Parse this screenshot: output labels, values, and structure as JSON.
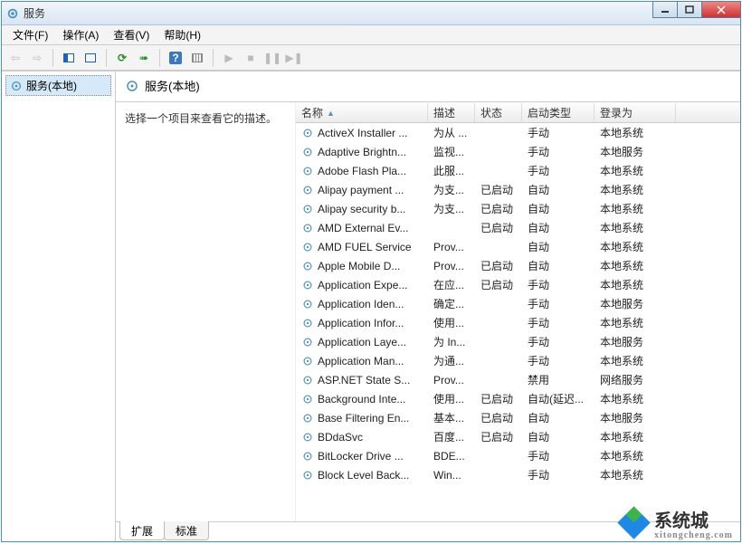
{
  "window": {
    "title": "服务",
    "url_hint": "...",
    "min_tooltip": "最小化",
    "max_tooltip": "最大化",
    "close_tooltip": "关闭"
  },
  "menus": [
    "文件(F)",
    "操作(A)",
    "查看(V)",
    "帮助(H)"
  ],
  "toolbar_icons": {
    "back": "←",
    "forward": "→",
    "up": "⇧",
    "show_tree": "▤",
    "refresh": "⟳",
    "export": "✎",
    "help": "?",
    "props": "☰",
    "start": "▶",
    "stop": "■",
    "pause": "❚❚",
    "restart": "⟲",
    "resume": "▸❚"
  },
  "tree": {
    "root_label": "服务(本地)"
  },
  "detail": {
    "title": "服务(本地)",
    "description_prompt": "选择一个项目来查看它的描述。"
  },
  "columns": {
    "name": "名称",
    "desc": "描述",
    "status": "状态",
    "startup": "启动类型",
    "logon": "登录为"
  },
  "services": [
    {
      "name": "ActiveX Installer ...",
      "desc": "为从 ...",
      "status": "",
      "startup": "手动",
      "logon": "本地系统"
    },
    {
      "name": "Adaptive Brightn...",
      "desc": "监视...",
      "status": "",
      "startup": "手动",
      "logon": "本地服务"
    },
    {
      "name": "Adobe Flash Pla...",
      "desc": "此服...",
      "status": "",
      "startup": "手动",
      "logon": "本地系统"
    },
    {
      "name": "Alipay payment ...",
      "desc": "为支...",
      "status": "已启动",
      "startup": "自动",
      "logon": "本地系统"
    },
    {
      "name": "Alipay security b...",
      "desc": "为支...",
      "status": "已启动",
      "startup": "自动",
      "logon": "本地系统"
    },
    {
      "name": "AMD External Ev...",
      "desc": "",
      "status": "已启动",
      "startup": "自动",
      "logon": "本地系统"
    },
    {
      "name": "AMD FUEL Service",
      "desc": "Prov...",
      "status": "",
      "startup": "自动",
      "logon": "本地系统"
    },
    {
      "name": "Apple Mobile D...",
      "desc": "Prov...",
      "status": "已启动",
      "startup": "自动",
      "logon": "本地系统"
    },
    {
      "name": "Application Expe...",
      "desc": "在应...",
      "status": "已启动",
      "startup": "手动",
      "logon": "本地系统"
    },
    {
      "name": "Application Iden...",
      "desc": "确定...",
      "status": "",
      "startup": "手动",
      "logon": "本地服务"
    },
    {
      "name": "Application Infor...",
      "desc": "使用...",
      "status": "",
      "startup": "手动",
      "logon": "本地系统"
    },
    {
      "name": "Application Laye...",
      "desc": "为 In...",
      "status": "",
      "startup": "手动",
      "logon": "本地服务"
    },
    {
      "name": "Application Man...",
      "desc": "为通...",
      "status": "",
      "startup": "手动",
      "logon": "本地系统"
    },
    {
      "name": "ASP.NET State S...",
      "desc": "Prov...",
      "status": "",
      "startup": "禁用",
      "logon": "网络服务"
    },
    {
      "name": "Background Inte...",
      "desc": "使用...",
      "status": "已启动",
      "startup": "自动(延迟...",
      "logon": "本地系统"
    },
    {
      "name": "Base Filtering En...",
      "desc": "基本...",
      "status": "已启动",
      "startup": "自动",
      "logon": "本地服务"
    },
    {
      "name": "BDdaSvc",
      "desc": "百度...",
      "status": "已启动",
      "startup": "自动",
      "logon": "本地系统"
    },
    {
      "name": "BitLocker Drive ...",
      "desc": "BDE...",
      "status": "",
      "startup": "手动",
      "logon": "本地系统"
    },
    {
      "name": "Block Level Back...",
      "desc": "Win...",
      "status": "",
      "startup": "手动",
      "logon": "本地系统"
    }
  ],
  "tabs": {
    "extended": "扩展",
    "standard": "标准"
  },
  "watermark": {
    "brand": "系统城",
    "sub": "xitongcheng.com"
  }
}
